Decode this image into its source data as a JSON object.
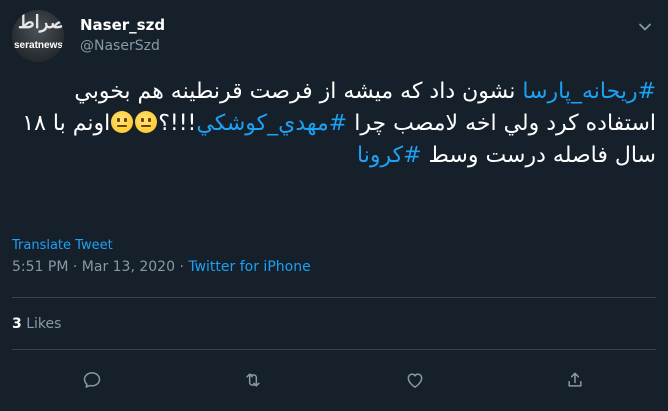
{
  "author": {
    "name": "Naser_szd",
    "handle": "@NaserSzd",
    "avatar_logo_text": "صراط",
    "avatar_watermark": "seratnews.ir"
  },
  "tweet": {
    "hashtag_1": "#ریحانه_پارسا",
    "text_1": " نشون داد که میشه از فرصت قرنطینه هم بخوبي استفاده کرد ولي اخه لامصب چرا ",
    "hashtag_2": "#مهدي_کوشکي",
    "text_2": "!!!؟",
    "text_3": "اونم با ۱۸ سال فاصله درست وسط ",
    "hashtag_3": "#کرونا",
    "emoji": "neutral-face-icon"
  },
  "translate_label": "Translate Tweet",
  "meta": {
    "time": "5:51 PM",
    "separator": " · ",
    "date": "Mar 13, 2020",
    "source": "Twitter for iPhone"
  },
  "likes": {
    "count": "3",
    "label": " Likes"
  },
  "actions": [
    "reply-icon",
    "retweet-icon",
    "like-icon",
    "share-icon"
  ],
  "colors": {
    "background": "#15202b",
    "accent": "#1da1f2",
    "muted": "#8899a6",
    "divider": "#38444d"
  }
}
